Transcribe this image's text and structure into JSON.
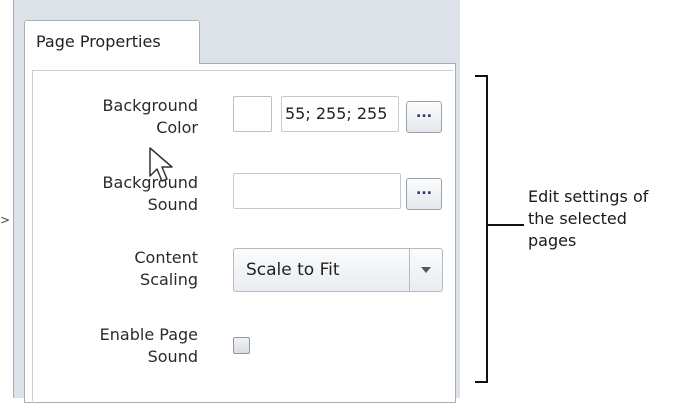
{
  "panel": {
    "tab_label": "Page Properties",
    "background_color": {
      "label": "Background\nColor",
      "value": "55; 255; 255",
      "swatch_color": "#ffffff",
      "browse_label": "..."
    },
    "background_sound": {
      "label": "Background\nSound",
      "value": "",
      "browse_label": "..."
    },
    "content_scaling": {
      "label": "Content\nScaling",
      "selected": "Scale to Fit"
    },
    "enable_page_sound": {
      "label": "Enable Page\nSound",
      "checked": false
    }
  },
  "annotation": {
    "text": "Edit settings of\nthe selected\npages"
  },
  "edge_glyph": ">"
}
